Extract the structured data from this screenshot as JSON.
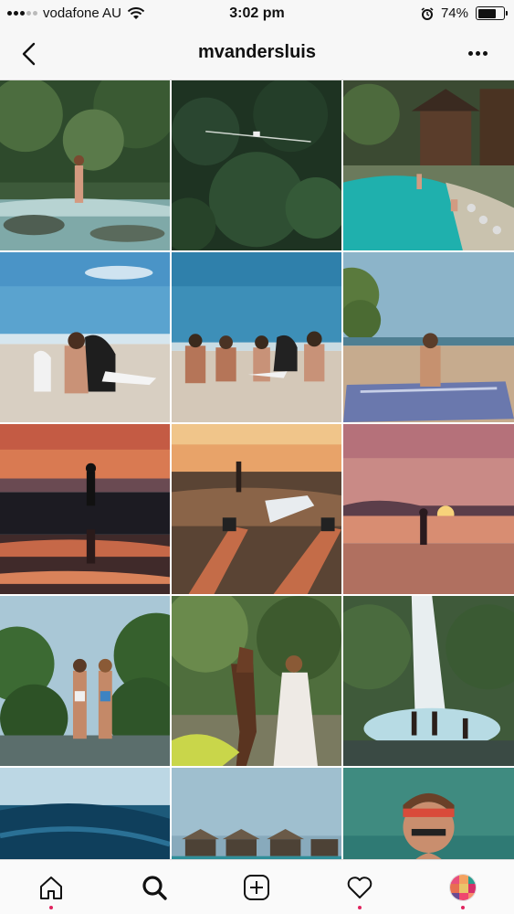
{
  "status_bar": {
    "carrier": "vodafone AU",
    "time": "3:02 pm",
    "battery": "74%",
    "battery_level": 0.74,
    "icons": [
      "signal-icon",
      "wifi-icon",
      "alarm-icon",
      "battery-icon"
    ]
  },
  "header": {
    "title": "mvandersluis",
    "back_icon": "chevron-left-icon",
    "more_icon": "more-horizontal-icon"
  },
  "grid": {
    "columns": 3,
    "photos": [
      "waterfall-river-woman",
      "aerial-jungle-bridge",
      "resort-pool",
      "beach-woman-with-dogs",
      "group-on-beach",
      "woman-on-beach-towel",
      "sunset-silhouette-tidepool",
      "legs-surfboard-sunset",
      "pink-sunset-beach-walk",
      "women-holding-hands-jungle",
      "woman-with-horse",
      "waterfall-swimmers",
      "ocean-wave",
      "overwater-bungalows",
      "woman-in-water-headband"
    ]
  },
  "tab_bar": {
    "tabs": [
      {
        "name": "home-icon",
        "label": "home"
      },
      {
        "name": "search-icon",
        "label": "search"
      },
      {
        "name": "new-post-icon",
        "label": "new post"
      },
      {
        "name": "heart-icon",
        "label": "activity"
      },
      {
        "name": "profile-avatar",
        "label": "profile"
      }
    ],
    "dot_color": "#e0245e"
  }
}
